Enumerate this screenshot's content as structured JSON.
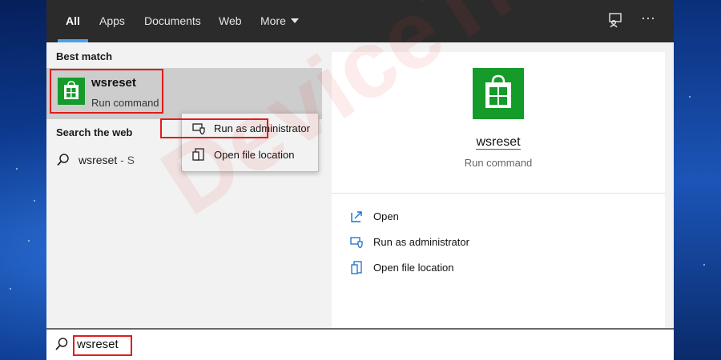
{
  "tabs": [
    {
      "label": "All",
      "active": true
    },
    {
      "label": "Apps",
      "active": false
    },
    {
      "label": "Documents",
      "active": false
    },
    {
      "label": "Web",
      "active": false
    },
    {
      "label": "More",
      "active": false
    }
  ],
  "toolbar": {
    "feedback_icon": "feedback-icon",
    "more_icon": "ellipsis-icon",
    "more_glyph": "···"
  },
  "best_match": {
    "section_label": "Best match",
    "app_name": "wsreset",
    "app_type": "Run command",
    "icon": "store-bag-icon"
  },
  "web": {
    "section_label": "Search the web",
    "query": "wsreset",
    "suffix": " - S"
  },
  "context_menu": {
    "items": [
      {
        "label": "Run as administrator",
        "icon": "shield-icon"
      },
      {
        "label": "Open file location",
        "icon": "file-location-icon"
      }
    ]
  },
  "preview": {
    "app_name": "wsreset",
    "app_type": "Run command",
    "actions": [
      {
        "label": "Open",
        "icon": "open-icon"
      },
      {
        "label": "Run as administrator",
        "icon": "shield-icon"
      },
      {
        "label": "Open file location",
        "icon": "file-location-icon"
      }
    ]
  },
  "search": {
    "value": "wsreset"
  },
  "watermark": {
    "text": "DeviceTricks"
  },
  "colors": {
    "accent": "#4aa0ec",
    "tile": "#159b2a",
    "highlight": "#e31b1b"
  }
}
